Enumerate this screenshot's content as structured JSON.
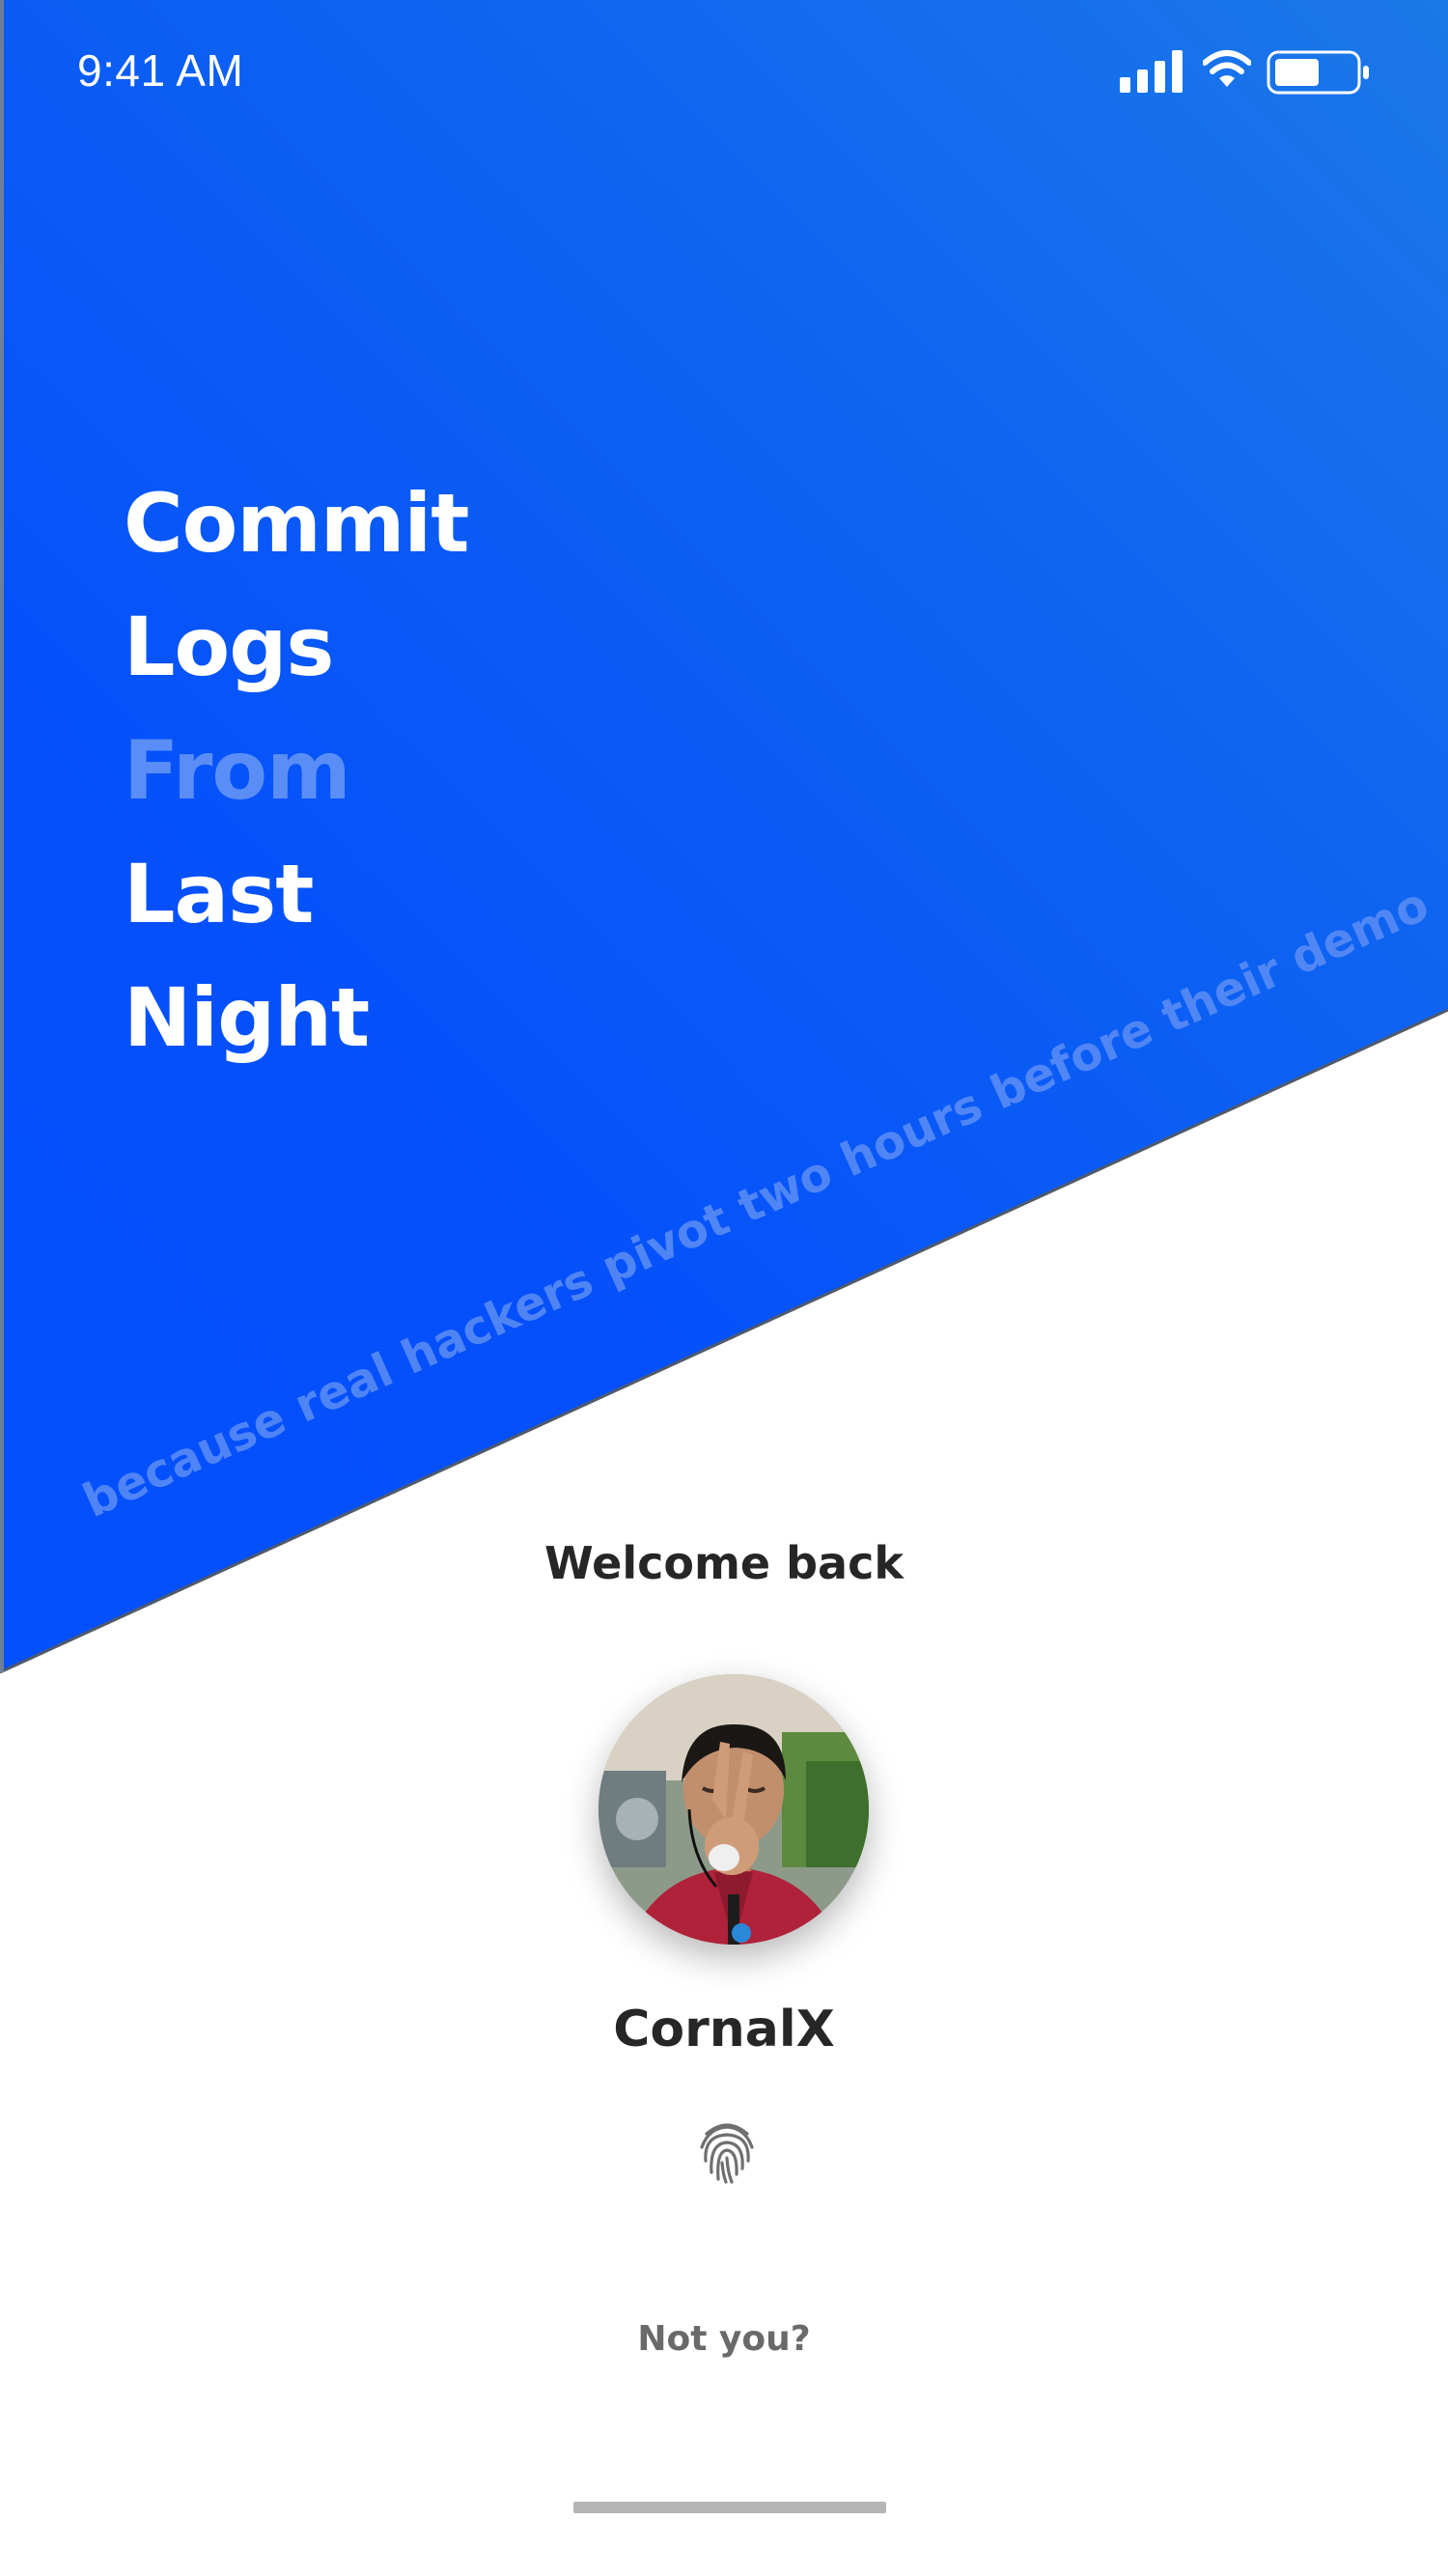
{
  "status_bar": {
    "time": "9:41 AM"
  },
  "hero": {
    "title_words": [
      "Commit",
      "Logs",
      "From",
      "Last",
      "Night"
    ],
    "tagline": "because real hackers pivot two hours before their demo"
  },
  "login": {
    "welcome": "Welcome back",
    "username": "CornalX",
    "not_you_link": "Not you?"
  },
  "icons": {
    "signal": "cellular-signal-icon",
    "wifi": "wifi-icon",
    "battery": "battery-icon",
    "fingerprint": "fingerprint-icon"
  },
  "colors": {
    "primary_blue": "#0450fc",
    "gradient_light": "#1b78e8",
    "dim_word": "#5a8ef6",
    "text_dark": "#262626",
    "text_muted": "#6a6a6a"
  }
}
